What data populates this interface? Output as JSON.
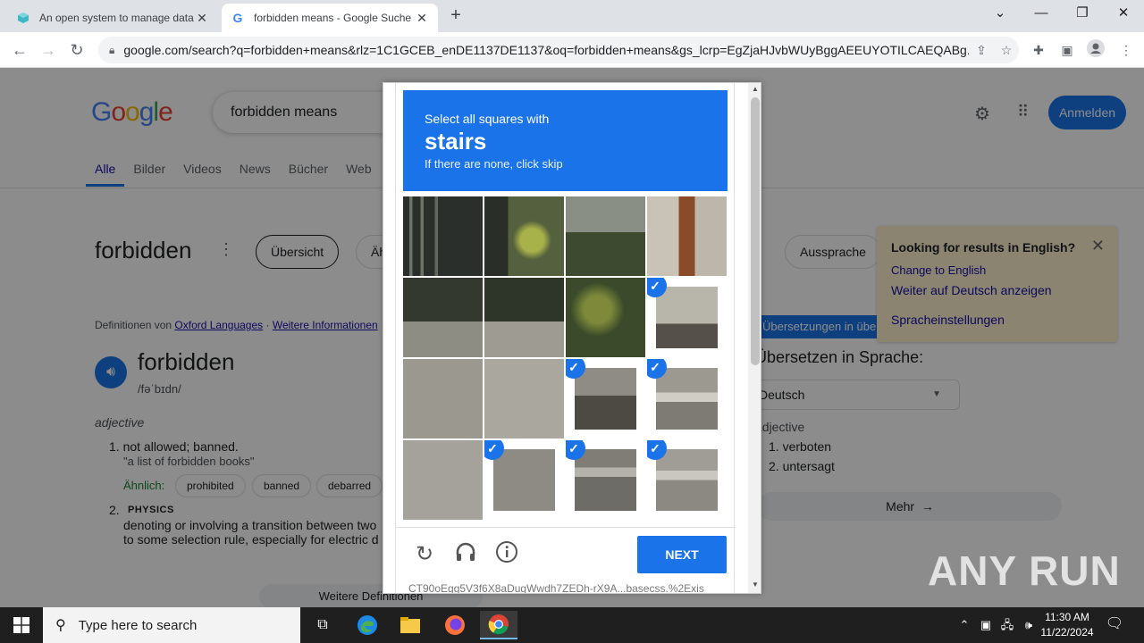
{
  "browser": {
    "tabs": [
      {
        "title": "An open system to manage data",
        "icon": "cube-icon"
      },
      {
        "title": "forbidden means - Google Suche",
        "icon": "google-g-icon"
      }
    ],
    "url": "google.com/search?q=forbidden+means&rlz=1C1GCEB_enDE1137DE1137&oq=forbidden+means&gs_lcrp=EgZjaHJvbWUyBggAEEUYOTILCAEQABg..."
  },
  "google": {
    "logo": "Google",
    "query": "forbidden means",
    "signin": "Anmelden",
    "tabs": [
      "Alle",
      "Bilder",
      "Videos",
      "News",
      "Bücher",
      "Web"
    ],
    "word": "forbidden",
    "chips": [
      "Übersicht",
      "Äh",
      "Aussprache"
    ],
    "source_prefix": "Definitionen von",
    "source_link": "Oxford Languages",
    "more_info": "Weitere Informationen",
    "headword": "forbidden",
    "phonetic": "/fəˈbɪdn/",
    "pos": "adjective",
    "def1": "1.  not allowed; banned.",
    "ex1": "\"a list of forbidden books\"",
    "similar_label": "Ähnlich:",
    "similar": [
      "prohibited",
      "banned",
      "debarred"
    ],
    "def2_num": "2.",
    "def2_tag": "PHYSICS",
    "def2_line1": "denoting or involving a transition between two",
    "def2_line2": "to some selection rule, especially for electric d",
    "more_defs": "Weitere Definitionen",
    "trans_bar": "Übersetzungen in über",
    "trans_title": "Übersetzen in Sprache:",
    "trans_lang": "Deutsch",
    "trans_pos": "adjective",
    "trans1": "1.  verboten",
    "trans2": "2.  untersagt",
    "mehr": "Mehr"
  },
  "notice": {
    "title": "Looking for results in English?",
    "link1": "Change to English",
    "link2": "Weiter auf Deutsch anzeigen",
    "link3": "Spracheinstellungen"
  },
  "captcha": {
    "instruction": "Select all squares with",
    "target": "stairs",
    "hint": "If there are none, click skip",
    "selected_tiles": [
      7,
      10,
      11,
      13,
      14,
      15
    ],
    "next": "NEXT",
    "token": "CT90oEgg5V3f6X8aDugWwdh7ZEDh-rX9A...basecss.%2Exis"
  },
  "watermark": "ANY RUN",
  "taskbar": {
    "search_placeholder": "Type here to search",
    "time": "11:30 AM",
    "date": "11/22/2024"
  }
}
